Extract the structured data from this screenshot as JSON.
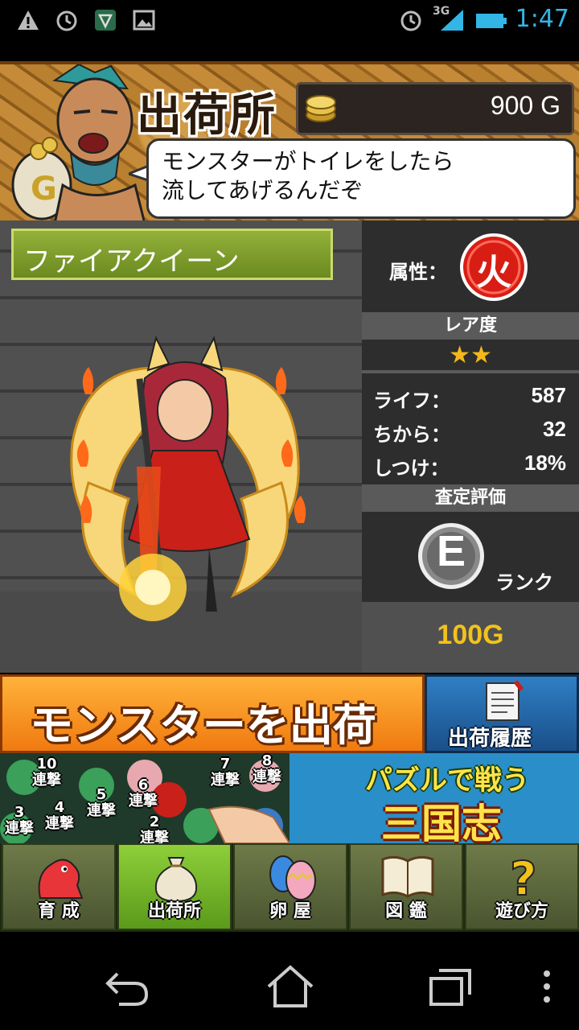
{
  "status_bar": {
    "time": "1:47",
    "network": "3G",
    "icons": [
      "warning-icon",
      "alarm-icon",
      "vpn-icon",
      "image-icon",
      "alarm-icon",
      "signal-icon",
      "battery-icon"
    ]
  },
  "header": {
    "title": "出荷所",
    "gold": "900 G",
    "speech": [
      "モンスターがトイレをしたら",
      "流してあげるんだぞ"
    ]
  },
  "monster": {
    "name": "ファイアクイーン"
  },
  "stats": {
    "attribute_label": "属性：",
    "attribute_value": "火",
    "rarity_label": "レア度",
    "rarity_stars": "★★",
    "life_label": "ライフ：",
    "life_value": "587",
    "power_label": "ちから：",
    "power_value": "32",
    "discipline_label": "しつけ：",
    "discipline_value": "18%",
    "appraisal_label": "査定評価",
    "rank_letter": "E",
    "rank_label": "ランク",
    "price": "100G"
  },
  "actions": {
    "ship_label": "モンスターを出荷",
    "history_label": "出荷履歴"
  },
  "ad": {
    "combos": [
      "10\n連撃",
      "5\n連撃",
      "6\n連撃",
      "7\n連撃",
      "8\n連撃",
      "4\n連撃",
      "3\n連撃",
      "2\n連撃"
    ],
    "title_line1": "パズルで戦う",
    "title_line2": "三国志"
  },
  "tabs": [
    {
      "label": "育 成",
      "icon": "dinosaur-icon"
    },
    {
      "label": "出荷所",
      "icon": "money-bag-icon"
    },
    {
      "label": "卵 屋",
      "icon": "eggs-icon"
    },
    {
      "label": "図 鑑",
      "icon": "book-icon"
    },
    {
      "label": "遊び方",
      "icon": "question-icon"
    }
  ],
  "colors": {
    "accent_orange": "#f07a10",
    "price_gold": "#f2c21b",
    "fire_red": "#d81e14",
    "tab_active": "#8ecf3a"
  }
}
